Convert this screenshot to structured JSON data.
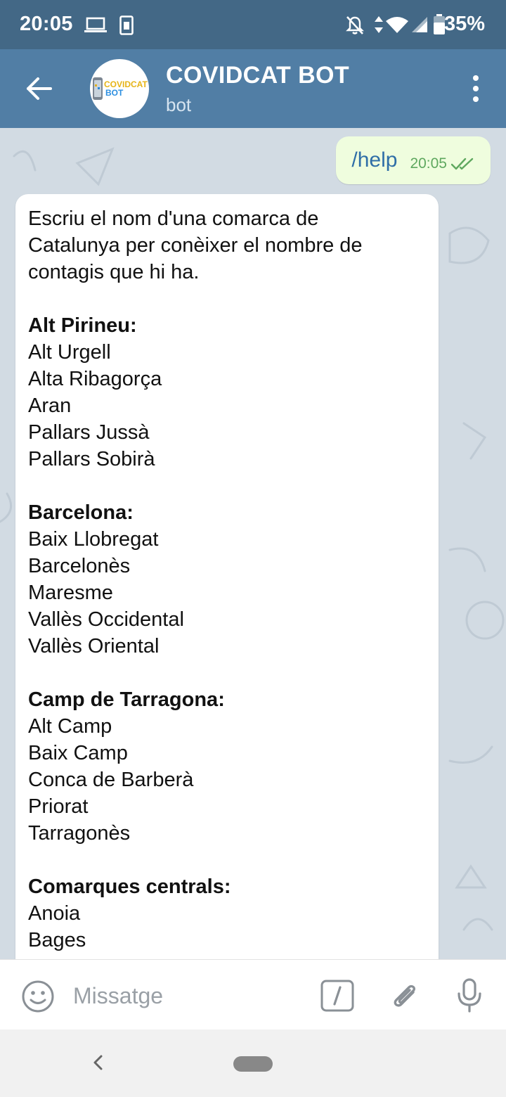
{
  "status_bar": {
    "time": "20:05",
    "battery": "35%",
    "icons": [
      "laptop-icon",
      "sim-icon",
      "notifications-off-icon",
      "data-arrows-icon",
      "wifi-icon",
      "signal-icon",
      "battery-icon"
    ]
  },
  "header": {
    "title": "COVIDCAT BOT",
    "subtitle": "bot",
    "avatar_text_top": "COVIDCAT",
    "avatar_text_bottom": "BOT",
    "colors": {
      "bar": "#517ea5",
      "status": "#436886"
    }
  },
  "messages": {
    "outgoing": {
      "text": "/help",
      "time": "20:05",
      "status": "read"
    },
    "incoming": {
      "lines": [
        "Escriu el nom d'una comarca de",
        "Catalunya per conèixer el nombre de",
        "contagis que hi ha.",
        "",
        "Alt Pirineu:",
        "Alt Urgell",
        "Alta Ribagorça",
        "Aran",
        "Pallars Jussà",
        "Pallars Sobirà",
        "",
        "Barcelona:",
        "Baix Llobregat",
        "Barcelonès",
        "Maresme",
        "Vallès Occidental",
        "Vallès Oriental",
        "",
        "Camp de Tarragona:",
        "Alt Camp",
        "Baix Camp",
        "Conca de Barberà",
        "Priorat",
        "Tarragonès",
        "",
        "Comarques centrals:",
        "Anoia",
        "Bages"
      ]
    }
  },
  "input": {
    "placeholder": "Missatge"
  },
  "colors": {
    "outgoing_bubble": "#effdde",
    "chat_bg": "#d2dbe3",
    "link": "#2f6ea7",
    "read_check": "#5fa85f"
  }
}
